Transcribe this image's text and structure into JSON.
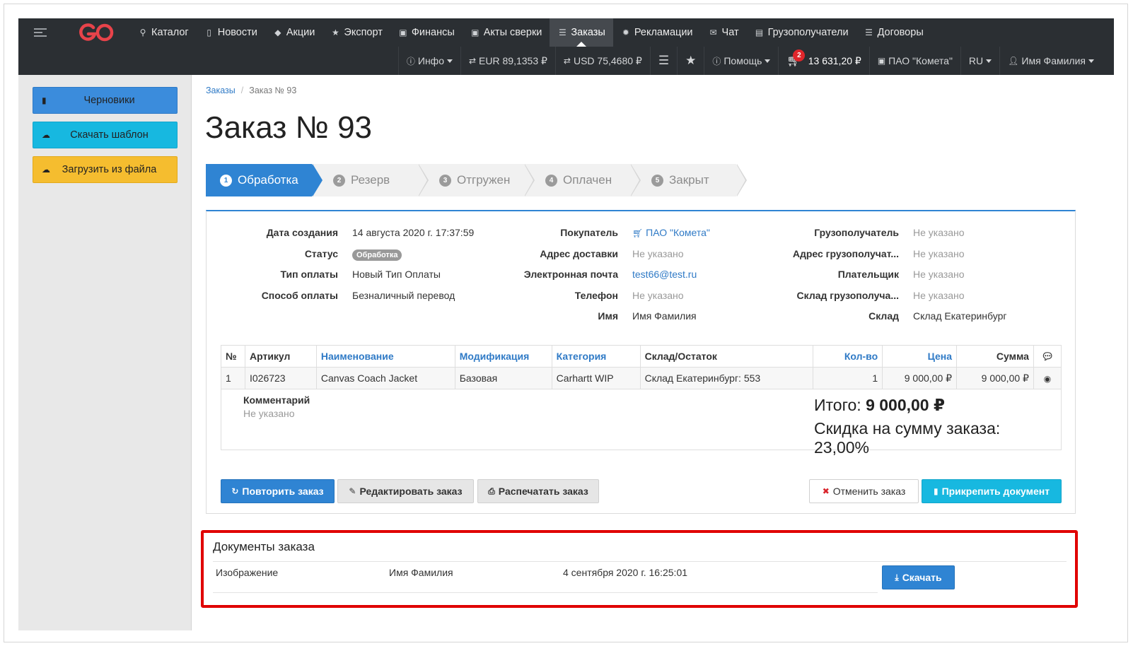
{
  "nav": {
    "menu": [
      {
        "icon": "sitemap-icon",
        "glyph": "⚲",
        "label": "Каталог"
      },
      {
        "icon": "file-icon",
        "glyph": "▯",
        "label": "Новости"
      },
      {
        "icon": "tag-icon",
        "glyph": "◆",
        "label": "Акции"
      },
      {
        "icon": "star-icon",
        "glyph": "★",
        "label": "Экспорт"
      },
      {
        "icon": "money-icon",
        "glyph": "▣",
        "label": "Финансы"
      },
      {
        "icon": "money-icon",
        "glyph": "▣",
        "label": "Акты сверки"
      },
      {
        "icon": "list-icon",
        "glyph": "☰",
        "label": "Заказы"
      },
      {
        "icon": "cog-icon",
        "glyph": "✹",
        "label": "Рекламации"
      },
      {
        "icon": "envelope-icon",
        "glyph": "✉",
        "label": "Чат"
      },
      {
        "icon": "archive-icon",
        "glyph": "▤",
        "label": "Грузополучатели"
      },
      {
        "icon": "list-icon",
        "glyph": "☰",
        "label": "Договоры"
      }
    ],
    "info_label": "Инфо",
    "eur_rate": "EUR 89,1353 ₽",
    "usd_rate": "USD 75,4680 ₽",
    "help_label": "Помощь",
    "cart_count": "2",
    "cart_total": "13 631,20 ₽",
    "company": "ПАО \"Комета\"",
    "language": "RU",
    "user_name": "Имя Фамилия"
  },
  "sidebar": {
    "drafts": "Черновики",
    "download_template": "Скачать шаблон",
    "upload_file": "Загрузить из файла"
  },
  "breadcrumb": {
    "root": "Заказы",
    "current": "Заказ № 93"
  },
  "page_title": "Заказ № 93",
  "steps": [
    {
      "num": "1",
      "label": "Обработка"
    },
    {
      "num": "2",
      "label": "Резерв"
    },
    {
      "num": "3",
      "label": "Отгружен"
    },
    {
      "num": "4",
      "label": "Оплачен"
    },
    {
      "num": "5",
      "label": "Закрыт"
    }
  ],
  "order_info": {
    "created_label": "Дата создания",
    "created_value": "14 августа 2020 г. 17:37:59",
    "status_label": "Статус",
    "status_value": "Обработка",
    "payment_type_label": "Тип оплаты",
    "payment_type_value": "Новый Тип Оплаты",
    "payment_method_label": "Способ оплаты",
    "payment_method_value": "Безналичный перевод",
    "buyer_label": "Покупатель",
    "buyer_value": "ПАО \"Комета\"",
    "delivery_address_label": "Адрес доставки",
    "delivery_address_value": "Не указано",
    "email_label": "Электронная почта",
    "email_value": "test66@test.ru",
    "phone_label": "Телефон",
    "phone_value": "Не указано",
    "name_label": "Имя",
    "name_value": "Имя Фамилия",
    "consignee_label": "Грузополучатель",
    "consignee_value": "Не указано",
    "consignee_address_label": "Адрес грузополучат...",
    "consignee_address_value": "Не указано",
    "payer_label": "Плательщик",
    "payer_value": "Не указано",
    "consignee_warehouse_label": "Склад грузополуча...",
    "consignee_warehouse_value": "Не указано",
    "warehouse_label": "Склад",
    "warehouse_value": "Склад Екатеринбург"
  },
  "table": {
    "headers": {
      "num": "№",
      "article": "Артикул",
      "name": "Наименование",
      "modification": "Модификация",
      "category": "Категория",
      "stock": "Склад/Остаток",
      "qty": "Кол-во",
      "price": "Цена",
      "sum": "Сумма"
    },
    "rows": [
      {
        "num": "1",
        "article": "I026723",
        "name": "Canvas Coach Jacket",
        "modification": "Базовая",
        "category": "Carhartt WIP",
        "stock": "Склад Екатеринбург: 553",
        "qty": "1",
        "price": "9 000,00 ₽",
        "sum": "9 000,00 ₽"
      }
    ]
  },
  "summary": {
    "comment_label": "Комментарий",
    "comment_value": "Не указано",
    "total_label": "Итого:",
    "total_value": "9 000,00 ₽",
    "discount": "Скидка на сумму заказа: 23,00%"
  },
  "actions": {
    "repeat": "Повторить заказ",
    "edit": "Редактировать заказ",
    "print": "Распечатать заказ",
    "cancel": "Отменить заказ",
    "attach": "Прикрепить документ"
  },
  "documents": {
    "title": "Документы заказа",
    "items": [
      {
        "type": "Изображение",
        "author": "Имя Фамилия",
        "date": "4 сентября 2020 г. 16:25:01",
        "download": "Скачать"
      }
    ]
  }
}
